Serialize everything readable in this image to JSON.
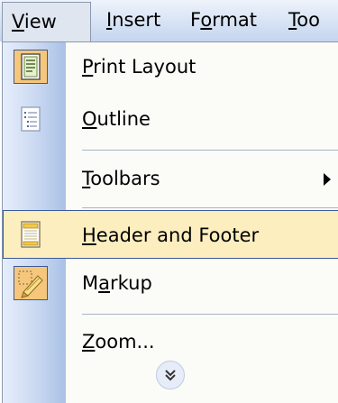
{
  "menubar": {
    "view": {
      "pre": "",
      "key": "V",
      "post": "iew"
    },
    "insert": {
      "pre": "",
      "key": "I",
      "post": "nsert"
    },
    "format": {
      "pre": "F",
      "key": "o",
      "post": "rmat"
    },
    "tools": {
      "pre": "",
      "key": "T",
      "post": "oo"
    }
  },
  "menu": {
    "items": [
      {
        "pre": "",
        "key": "P",
        "post": "rint Layout",
        "icon": "print-layout-icon",
        "checked": true
      },
      {
        "pre": "",
        "key": "O",
        "post": "utline",
        "icon": "outline-icon"
      },
      {
        "pre": "",
        "key": "T",
        "post": "oolbars",
        "submenu": true
      },
      {
        "pre": "",
        "key": "H",
        "post": "eader and Footer",
        "icon": "header-footer-icon",
        "highlighted": true
      },
      {
        "pre": "M",
        "key": "a",
        "post": "rkup",
        "icon": "markup-icon",
        "checked": true
      },
      {
        "pre": "",
        "key": "Z",
        "post": "oom...",
        "icon": ""
      }
    ],
    "expand_icon": "chevron-double-down-icon"
  },
  "colors": {
    "highlight_bg": "#fdeebf",
    "highlight_border": "#3b5a9a",
    "gutter": "#c9d8f1",
    "menubar": "#d9e4f5"
  }
}
